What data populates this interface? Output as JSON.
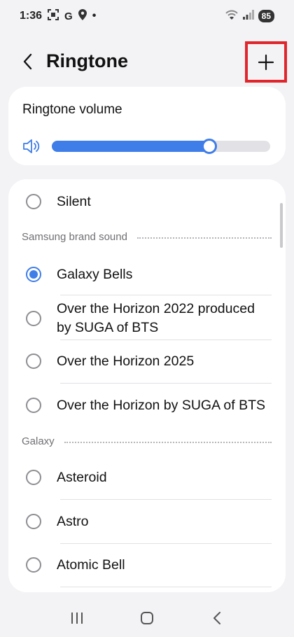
{
  "status_bar": {
    "time": "1:36",
    "icons": [
      "screenshot-icon",
      "google-icon",
      "location-icon",
      "dot-icon"
    ],
    "google_letter": "G",
    "dot": "•",
    "battery": "85"
  },
  "header": {
    "title": "Ringtone",
    "back_icon": "chevron-left-icon",
    "add_icon": "plus-icon",
    "add_highlight_color": "#e0262c"
  },
  "volume": {
    "label": "Ringtone volume",
    "level": 0.72,
    "accent_color": "#3f7de8"
  },
  "list": {
    "silent": {
      "label": "Silent",
      "checked": false
    },
    "sections": [
      {
        "title": "Samsung brand sound",
        "items": [
          {
            "label": "Galaxy Bells",
            "checked": true
          },
          {
            "label": "Over the Horizon 2022 produced by SUGA of BTS",
            "checked": false
          },
          {
            "label": "Over the Horizon 2025",
            "checked": false
          },
          {
            "label": "Over the Horizon by SUGA of BTS",
            "checked": false
          }
        ]
      },
      {
        "title": "Galaxy",
        "items": [
          {
            "label": "Asteroid",
            "checked": false
          },
          {
            "label": "Astro",
            "checked": false
          },
          {
            "label": "Atomic Bell",
            "checked": false
          }
        ]
      }
    ]
  },
  "nav": {
    "recents_icon": "recents-icon",
    "home_icon": "home-icon",
    "back_icon": "back-icon"
  }
}
